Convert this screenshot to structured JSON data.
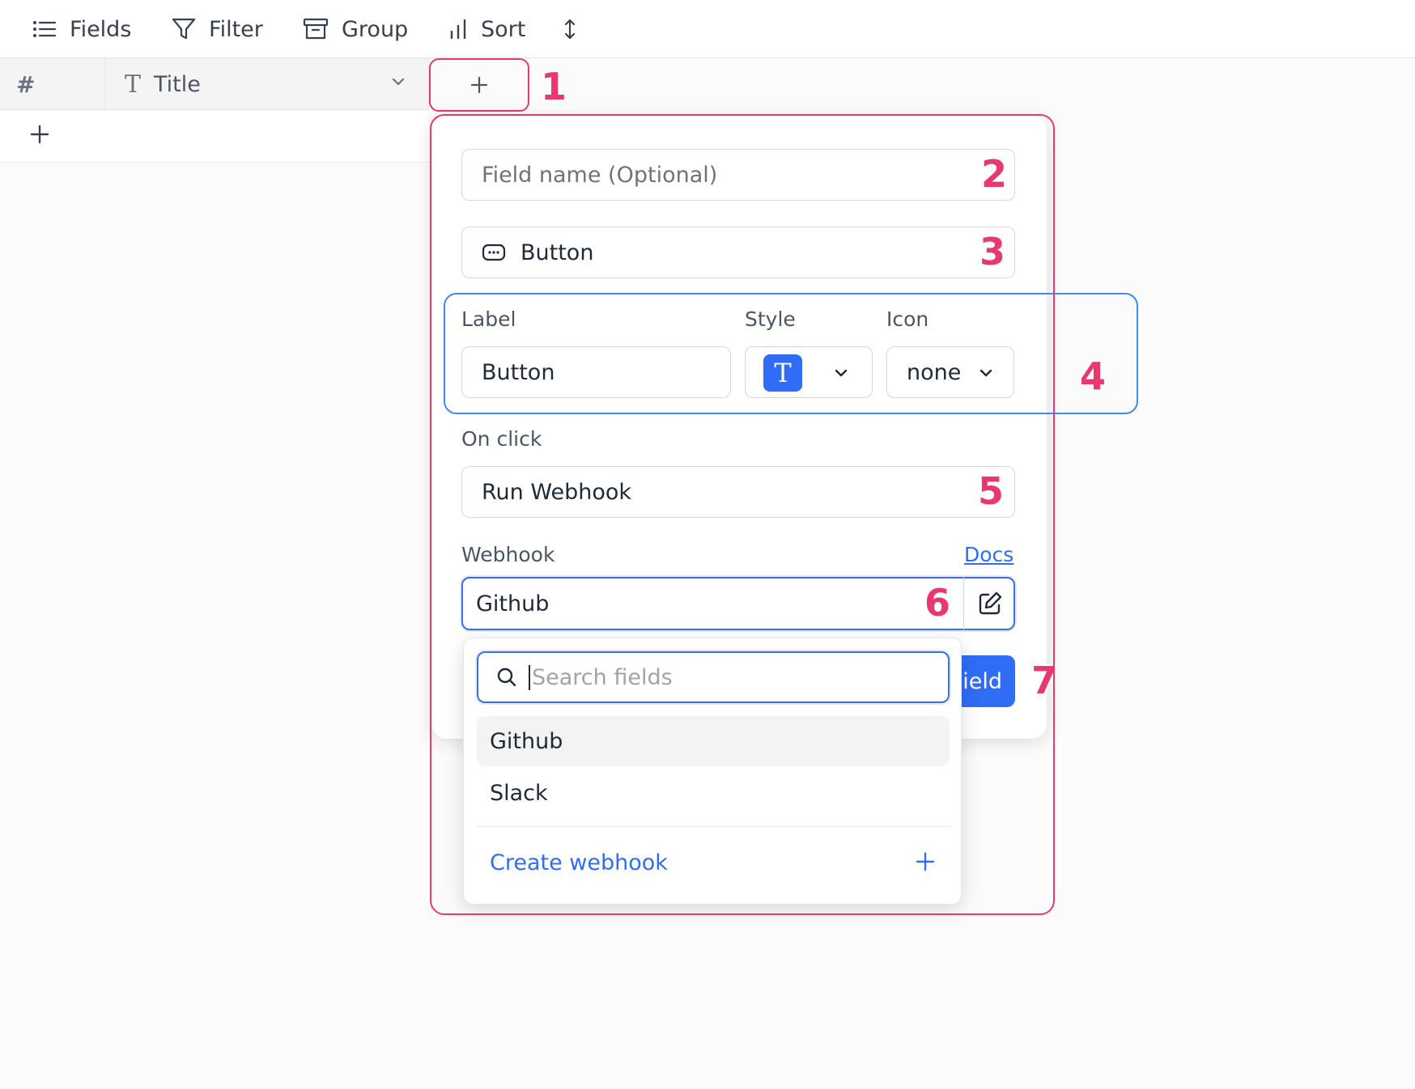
{
  "toolbar": {
    "fields_label": "Fields",
    "filter_label": "Filter",
    "group_label": "Group",
    "sort_label": "Sort"
  },
  "grid": {
    "columns": [
      {
        "label": "#"
      },
      {
        "label": "Title",
        "icon": "text-type-icon"
      }
    ]
  },
  "annotations": [
    "1",
    "2",
    "3",
    "4",
    "5",
    "6",
    "7"
  ],
  "form": {
    "field_name_placeholder": "Field name (Optional)",
    "field_type": "Button",
    "label_heading": "Label",
    "style_heading": "Style",
    "icon_heading": "Icon",
    "label_value": "Button",
    "style_value": "T",
    "icon_value": "none",
    "on_click_heading": "On click",
    "on_click_value": "Run Webhook",
    "webhook_heading": "Webhook",
    "docs_link": "Docs",
    "webhook_value": "Github",
    "save_button_partial": "ield"
  },
  "dropdown": {
    "search_placeholder": "Search fields",
    "options": [
      "Github",
      "Slack"
    ],
    "create_label": "Create webhook"
  },
  "colors": {
    "accent": "#2f6df6",
    "annotation": "#e8386d",
    "annotation_blue": "#3b8df0"
  }
}
